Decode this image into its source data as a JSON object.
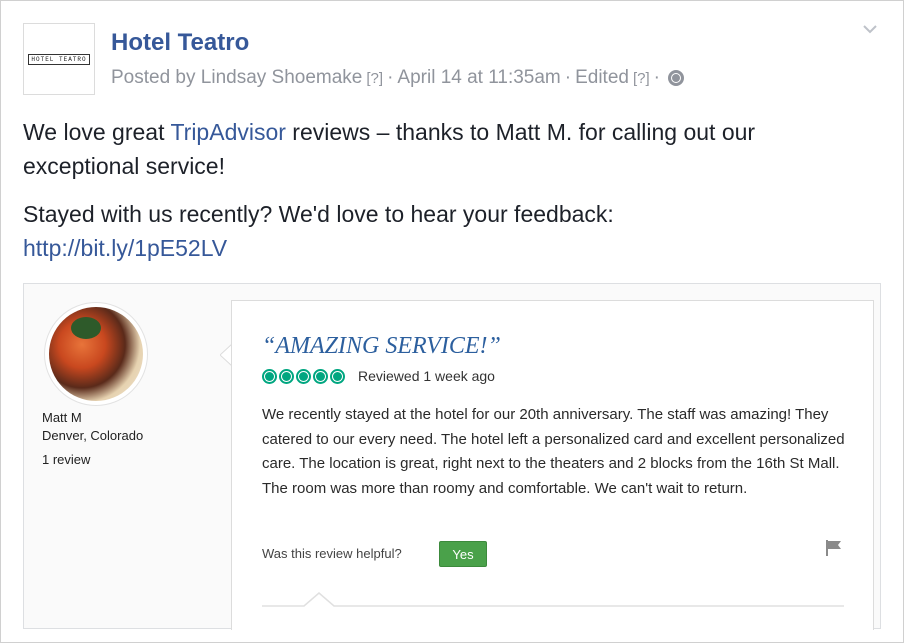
{
  "post": {
    "page_name": "Hotel Teatro",
    "logo_text": "HOTEL TEATRO",
    "meta": {
      "posted_by": "Posted by Lindsay Shoemake",
      "help1": "[?]",
      "sep1": "·",
      "date": "April 14 at 11:35am",
      "sep2": "·",
      "edited": "Edited",
      "help2": "[?]",
      "sep3": "·"
    },
    "text1_a": "We love great ",
    "text1_link": "TripAdvisor",
    "text1_b": " reviews – thanks to Matt M. for calling out our exceptional service!",
    "text2": "Stayed with us recently? We'd love to hear your feedback:",
    "url": "http://bit.ly/1pE52LV"
  },
  "review": {
    "reviewer_name": "Matt M",
    "reviewer_location": "Denver, Colorado",
    "reviewer_count": "1 review",
    "title": "“AMAZING SERVICE!”",
    "rating": 5,
    "reviewed": "Reviewed 1 week ago",
    "body": "We recently stayed at the hotel for our 20th anniversary. The staff was amazing! They catered to our every need. The hotel left a personalized card and excellent personalized care. The location is great, right next to the theaters and 2 blocks from the 16th St Mall. The room was more than roomy and comfortable. We can't wait to return.",
    "helpful_question": "Was this review helpful?",
    "yes_label": "Yes"
  },
  "colors": {
    "link": "#365899",
    "meta": "#90949c",
    "tripadvisor_green": "#00a680",
    "yes_button": "#4aa14a",
    "title_blue": "#2c5f9e"
  },
  "icons": {
    "globe": "globe-icon",
    "chevron": "chevron-down-icon",
    "flag": "flag-icon"
  }
}
